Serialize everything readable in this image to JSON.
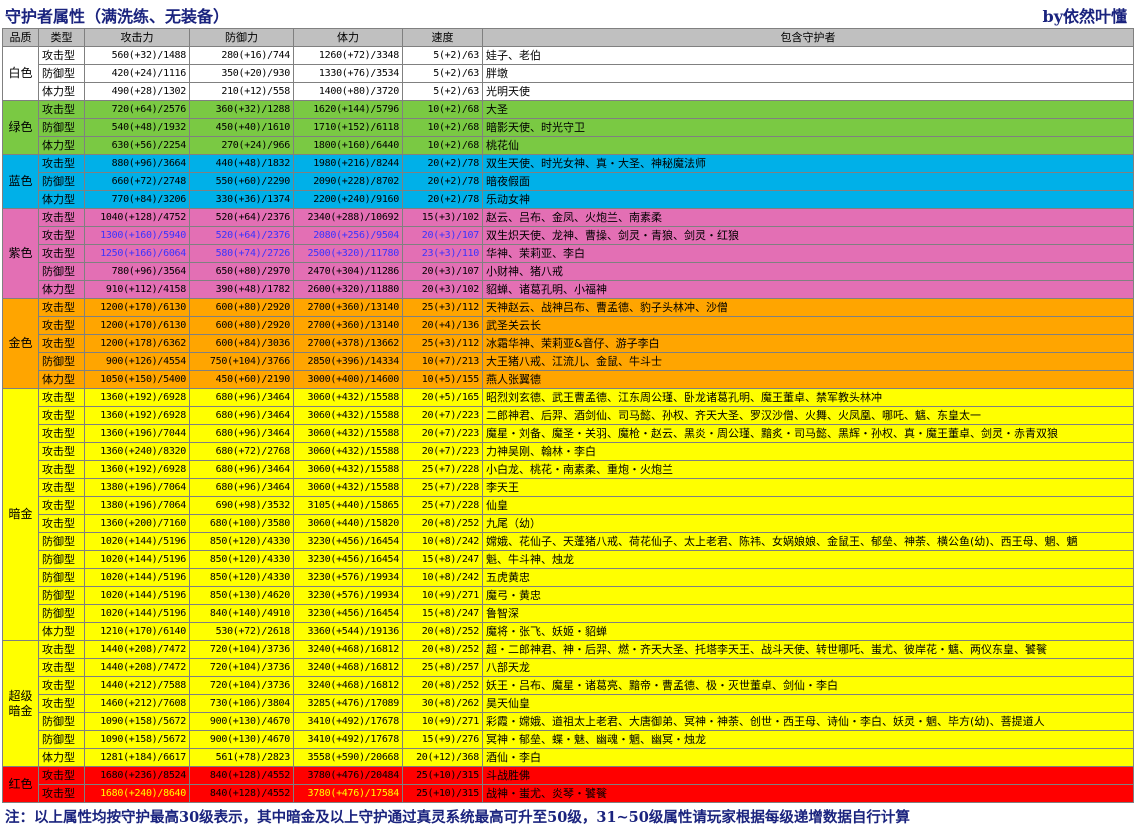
{
  "title": "守护者属性（满洗练、无装备）",
  "author": "by依然叶懂",
  "headers": [
    "品质",
    "类型",
    "攻击力",
    "防御力",
    "体力",
    "速度",
    "包含守护者"
  ],
  "groups": [
    {
      "quality": "白色",
      "color": "#ffffff",
      "rows": [
        {
          "type": "攻击型",
          "atk": "560(+32)/1488",
          "def": "280(+16)/744",
          "hp": "1260(+72)/3348",
          "spd": "5(+2)/63",
          "members": "娃子、老伯"
        },
        {
          "type": "防御型",
          "atk": "420(+24)/1116",
          "def": "350(+20)/930",
          "hp": "1330(+76)/3534",
          "spd": "5(+2)/63",
          "members": "胖墩"
        },
        {
          "type": "体力型",
          "atk": "490(+28)/1302",
          "def": "210(+12)/558",
          "hp": "1400(+80)/3720",
          "spd": "5(+2)/63",
          "members": "光明天使"
        }
      ]
    },
    {
      "quality": "绿色",
      "color": "#7ac943",
      "rows": [
        {
          "type": "攻击型",
          "atk": "720(+64)/2576",
          "def": "360(+32)/1288",
          "hp": "1620(+144)/5796",
          "spd": "10(+2)/68",
          "members": "大圣"
        },
        {
          "type": "防御型",
          "atk": "540(+48)/1932",
          "def": "450(+40)/1610",
          "hp": "1710(+152)/6118",
          "spd": "10(+2)/68",
          "members": "暗影天使、时光守卫"
        },
        {
          "type": "体力型",
          "atk": "630(+56)/2254",
          "def": "270(+24)/966",
          "hp": "1800(+160)/6440",
          "spd": "10(+2)/68",
          "members": "桃花仙"
        }
      ]
    },
    {
      "quality": "蓝色",
      "color": "#00b0e8",
      "rows": [
        {
          "type": "攻击型",
          "atk": "880(+96)/3664",
          "def": "440(+48)/1832",
          "hp": "1980(+216)/8244",
          "spd": "20(+2)/78",
          "members": "双生天使、时光女神、真・大圣、神秘魔法师"
        },
        {
          "type": "防御型",
          "atk": "660(+72)/2748",
          "def": "550(+60)/2290",
          "hp": "2090(+228)/8702",
          "spd": "20(+2)/78",
          "members": "暗夜假面"
        },
        {
          "type": "体力型",
          "atk": "770(+84)/3206",
          "def": "330(+36)/1374",
          "hp": "2200(+240)/9160",
          "spd": "20(+2)/78",
          "members": "乐动女神"
        }
      ]
    },
    {
      "quality": "紫色",
      "color": "#e36fb4",
      "rows": [
        {
          "type": "攻击型",
          "atk": "1040(+128)/4752",
          "def": "520(+64)/2376",
          "hp": "2340(+288)/10692",
          "spd": "15(+3)/102",
          "members": "赵云、吕布、金凤、火炮兰、南素柔",
          "hl": false
        },
        {
          "type": "攻击型",
          "atk": "1300(+160)/5940",
          "def": "520(+64)/2376",
          "hp": "2080(+256)/9504",
          "spd": "20(+3)/107",
          "members": "双生炽天使、龙神、曹操、剑灵・青狼、剑灵・红狼",
          "hl": true
        },
        {
          "type": "攻击型",
          "atk": "1250(+166)/6064",
          "def": "580(+74)/2726",
          "hp": "2500(+320)/11780",
          "spd": "23(+3)/110",
          "members": "华神、茉莉亚、李白",
          "hl": true
        },
        {
          "type": "防御型",
          "atk": "780(+96)/3564",
          "def": "650(+80)/2970",
          "hp": "2470(+304)/11286",
          "spd": "20(+3)/107",
          "members": "小财神、猪八戒",
          "hl": false
        },
        {
          "type": "体力型",
          "atk": "910(+112)/4158",
          "def": "390(+48)/1782",
          "hp": "2600(+320)/11880",
          "spd": "20(+3)/102",
          "members": "貂蝉、诸葛孔明、小福神",
          "hl": false
        }
      ]
    },
    {
      "quality": "金色",
      "color": "#ffa500",
      "rows": [
        {
          "type": "攻击型",
          "atk": "1200(+170)/6130",
          "def": "600(+80)/2920",
          "hp": "2700(+360)/13140",
          "spd": "25(+3)/112",
          "members": "天神赵云、战神吕布、曹孟德、豹子头林冲、沙僧"
        },
        {
          "type": "攻击型",
          "atk": "1200(+170)/6130",
          "def": "600(+80)/2920",
          "hp": "2700(+360)/13140",
          "spd": "20(+4)/136",
          "members": "武圣关云长"
        },
        {
          "type": "攻击型",
          "atk": "1200(+178)/6362",
          "def": "600(+84)/3036",
          "hp": "2700(+378)/13662",
          "spd": "25(+3)/112",
          "members": "冰霜华神、茉莉亚&音仔、游子李白"
        },
        {
          "type": "防御型",
          "atk": "900(+126)/4554",
          "def": "750(+104)/3766",
          "hp": "2850(+396)/14334",
          "spd": "10(+7)/213",
          "members": "大王猪八戒、江流儿、金鼠、牛斗士"
        },
        {
          "type": "体力型",
          "atk": "1050(+150)/5400",
          "def": "450(+60)/2190",
          "hp": "3000(+400)/14600",
          "spd": "10(+5)/155",
          "members": "燕人张翼德"
        }
      ]
    },
    {
      "quality": "暗金",
      "color": "#ffff00",
      "rows": [
        {
          "type": "攻击型",
          "atk": "1360(+192)/6928",
          "def": "680(+96)/3464",
          "hp": "3060(+432)/15588",
          "spd": "20(+5)/165",
          "members": "昭烈刘玄德、武王曹孟德、江东周公瑾、卧龙诸葛孔明、魔王董卓、禁军教头林冲"
        },
        {
          "type": "攻击型",
          "atk": "1360(+192)/6928",
          "def": "680(+96)/3464",
          "hp": "3060(+432)/15588",
          "spd": "20(+7)/223",
          "members": "二郎神君、后羿、酒剑仙、司马懿、孙权、齐天大圣、罗汉沙僧、火舞、火凤凰、哪吒、魑、东皇太一"
        },
        {
          "type": "攻击型",
          "atk": "1360(+196)/7044",
          "def": "680(+96)/3464",
          "hp": "3060(+432)/15588",
          "spd": "20(+7)/223",
          "members": "魔星・刘备、魔圣・关羽、魔枪・赵云、黑炎・周公瑾、黯炙・司马懿、黑辉・孙权、真・魔王董卓、剑灵・赤青双狼"
        },
        {
          "type": "攻击型",
          "atk": "1360(+240)/8320",
          "def": "680(+72)/2768",
          "hp": "3060(+432)/15588",
          "spd": "20(+7)/223",
          "members": "力神吴刚、翰林・李白"
        },
        {
          "type": "攻击型",
          "atk": "1360(+192)/6928",
          "def": "680(+96)/3464",
          "hp": "3060(+432)/15588",
          "spd": "25(+7)/228",
          "members": "小白龙、桃花・南素柔、重炮・火炮兰"
        },
        {
          "type": "攻击型",
          "atk": "1380(+196)/7064",
          "def": "680(+96)/3464",
          "hp": "3060(+432)/15588",
          "spd": "25(+7)/228",
          "members": "李天王"
        },
        {
          "type": "攻击型",
          "atk": "1380(+196)/7064",
          "def": "690(+98)/3532",
          "hp": "3105(+440)/15865",
          "spd": "25(+7)/228",
          "members": "仙皇"
        },
        {
          "type": "攻击型",
          "atk": "1360(+200)/7160",
          "def": "680(+100)/3580",
          "hp": "3060(+440)/15820",
          "spd": "20(+8)/252",
          "members": "九尾（幼）"
        },
        {
          "type": "防御型",
          "atk": "1020(+144)/5196",
          "def": "850(+120)/4330",
          "hp": "3230(+456)/16454",
          "spd": "10(+8)/242",
          "members": "嫦娥、花仙子、天蓬猪八戒、荷花仙子、太上老君、陈祎、女娲娘娘、金鼠王、郁垒、神荼、横公鱼(幼)、西王母、魍、魉"
        },
        {
          "type": "防御型",
          "atk": "1020(+144)/5196",
          "def": "850(+120)/4330",
          "hp": "3230(+456)/16454",
          "spd": "15(+8)/247",
          "members": "魁、牛斗神、烛龙"
        },
        {
          "type": "防御型",
          "atk": "1020(+144)/5196",
          "def": "850(+120)/4330",
          "hp": "3230(+576)/19934",
          "spd": "10(+8)/242",
          "members": "五虎黄忠"
        },
        {
          "type": "防御型",
          "atk": "1020(+144)/5196",
          "def": "850(+130)/4620",
          "hp": "3230(+576)/19934",
          "spd": "10(+9)/271",
          "members": "魔弓・黄忠"
        },
        {
          "type": "防御型",
          "atk": "1020(+144)/5196",
          "def": "840(+140)/4910",
          "hp": "3230(+456)/16454",
          "spd": "15(+8)/247",
          "members": "鲁智深"
        },
        {
          "type": "体力型",
          "atk": "1210(+170)/6140",
          "def": "530(+72)/2618",
          "hp": "3360(+544)/19136",
          "spd": "20(+8)/252",
          "members": "魔将・张飞、妖姬・貂蝉"
        }
      ]
    },
    {
      "quality": "超级暗金",
      "color": "#ffff00",
      "rows": [
        {
          "type": "攻击型",
          "atk": "1440(+208)/7472",
          "def": "720(+104)/3736",
          "hp": "3240(+468)/16812",
          "spd": "20(+8)/252",
          "members": "超・二郎神君、神・后羿、燃・齐天大圣、托塔李天王、战斗天使、转世哪吒、蚩尤、彼岸花・魑、两仪东皇、饕餮"
        },
        {
          "type": "攻击型",
          "atk": "1440(+208)/7472",
          "def": "720(+104)/3736",
          "hp": "3240(+468)/16812",
          "spd": "25(+8)/257",
          "members": "八部天龙"
        },
        {
          "type": "攻击型",
          "atk": "1440(+212)/7588",
          "def": "720(+104)/3736",
          "hp": "3240(+468)/16812",
          "spd": "20(+8)/252",
          "members": "妖王・吕布、魔星・诸葛亮、黯帝・曹孟德、极・灭世董卓、剑仙・李白"
        },
        {
          "type": "攻击型",
          "atk": "1460(+212)/7608",
          "def": "730(+106)/3804",
          "hp": "3285(+476)/17089",
          "spd": "30(+8)/262",
          "members": "昊天仙皇"
        },
        {
          "type": "防御型",
          "atk": "1090(+158)/5672",
          "def": "900(+130)/4670",
          "hp": "3410(+492)/17678",
          "spd": "10(+9)/271",
          "members": "彩霞・嫦娥、道祖太上老君、大唐御弟、冥神・神荼、创世・西王母、诗仙・李白、妖灵・魍、毕方(幼)、菩提道人"
        },
        {
          "type": "防御型",
          "atk": "1090(+158)/5672",
          "def": "900(+130)/4670",
          "hp": "3410(+492)/17678",
          "spd": "15(+9)/276",
          "members": "冥神・郁垒、蝶・魅、幽魂・魍、幽冥・烛龙"
        },
        {
          "type": "体力型",
          "atk": "1281(+184)/6617",
          "def": "561(+78)/2823",
          "hp": "3558(+590)/20668",
          "spd": "20(+12)/368",
          "members": "酒仙・李白"
        }
      ]
    },
    {
      "quality": "红色",
      "color": "#ff0000",
      "rows": [
        {
          "type": "攻击型",
          "atk": "1680(+236)/8524",
          "def": "840(+128)/4552",
          "hp": "3780(+476)/20484",
          "spd": "25(+10)/315",
          "members": "斗战胜佛"
        },
        {
          "type": "攻击型",
          "atk": "1680(+240)/8640",
          "def": "840(+128)/4552",
          "hp": "3780(+476)/17584",
          "spd": "25(+10)/315",
          "members": "战神・蚩尤、炎琴・饕餮"
        }
      ]
    }
  ],
  "note": "注：以上属性均按守护最高30级表示，其中暗金及以上守护通过真灵系统最高可升至50级，31~50级属性请玩家根据每级递增数据自行计算"
}
